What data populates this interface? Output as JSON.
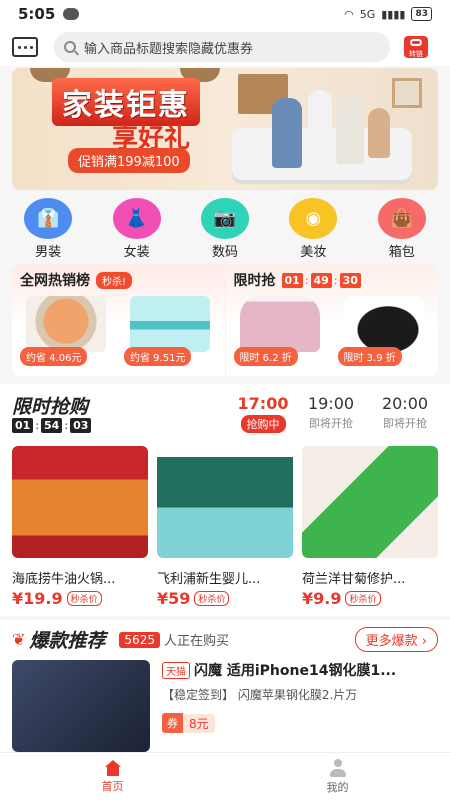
{
  "status": {
    "time": "5:05",
    "battery": "83",
    "network": "5G"
  },
  "search": {
    "placeholder": "输入商品标题搜索隐藏优惠券",
    "link_badge": "转链"
  },
  "banner": {
    "title": "家装钜惠",
    "subtitle": "享好礼",
    "promo": "促销满199减100"
  },
  "categories": [
    {
      "label": "男装",
      "icon": "shirt-icon",
      "color": "#4f8cf0"
    },
    {
      "label": "女装",
      "icon": "dress-icon",
      "color": "#f24fb4"
    },
    {
      "label": "数码",
      "icon": "camera-icon",
      "color": "#2fd3b7"
    },
    {
      "label": "美妆",
      "icon": "washer-icon",
      "color": "#f7c325"
    },
    {
      "label": "箱包",
      "icon": "bag-icon",
      "color": "#f66a6a"
    }
  ],
  "hot_rank": {
    "title": "全网热销榜",
    "tag": "秒杀!",
    "items": [
      {
        "save": "约省 4.06元"
      },
      {
        "save": "约省 9.51元"
      }
    ]
  },
  "limited": {
    "title": "限时抢",
    "timer": [
      "01",
      "49",
      "30"
    ],
    "items": [
      {
        "save": "限时 6.2 折"
      },
      {
        "save": "限时 3.9 折"
      }
    ]
  },
  "flash_sale": {
    "title": "限时抢购",
    "countdown": [
      "01",
      "54",
      "03"
    ],
    "slots": [
      {
        "time": "17:00",
        "status": "抢购中"
      },
      {
        "time": "19:00",
        "status": "即将开抢"
      },
      {
        "time": "20:00",
        "status": "即将开抢"
      }
    ],
    "products": [
      {
        "name": "海底捞牛油火锅...",
        "price": "¥19.9",
        "tag": "秒杀价"
      },
      {
        "name": "飞利浦新生婴儿...",
        "price": "¥59",
        "tag": "秒杀价"
      },
      {
        "name": "荷兰洋甘菊修护...",
        "price": "¥9.9",
        "tag": "秒杀价"
      }
    ]
  },
  "recommend": {
    "title": "爆款推荐",
    "count": "5625",
    "people_text": "人正在购买",
    "more": "更多爆款 ›",
    "item": {
      "platform": "天猫",
      "name": "闪魔 适用iPhone14钢化膜1...",
      "sub": "【稳定签到】 闪魔苹果钢化膜2.片万",
      "coupon_label": "券",
      "coupon_value": "8元"
    }
  },
  "tabs": [
    {
      "label": "首页"
    },
    {
      "label": "我的"
    }
  ],
  "colors": {
    "accent": "#e8392b",
    "background": "#f6f6f6"
  }
}
